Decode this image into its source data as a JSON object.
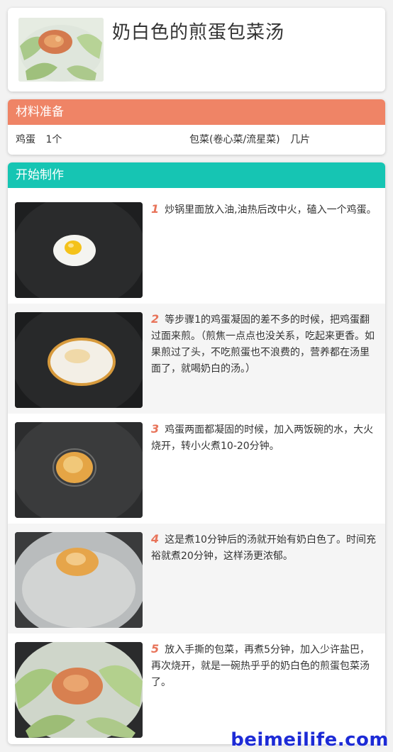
{
  "header": {
    "title": "奶白色的煎蛋包菜汤"
  },
  "ingredients": {
    "heading": "材料准备",
    "heading_color": "#ef8466",
    "items": [
      {
        "name": "鸡蛋",
        "amount": "1个"
      },
      {
        "name": "包菜(卷心菜/流星菜)",
        "amount": "几片"
      }
    ]
  },
  "steps": {
    "heading": "开始制作",
    "heading_color": "#16c5b3",
    "items": [
      {
        "num": "1",
        "text": "炒锅里面放入油,油热后改中火，磕入一个鸡蛋。"
      },
      {
        "num": "2",
        "text": "等步骤1的鸡蛋凝固的差不多的时候，把鸡蛋翻过面来煎。（煎焦一点点也没关系，吃起来更香。如果煎过了头，不吃煎蛋也不浪费的，营养都在汤里面了，就喝奶白的汤。）"
      },
      {
        "num": "3",
        "text": "鸡蛋两面都凝固的时候，加入两饭碗的水，大火烧开，转小火煮10-20分钟。"
      },
      {
        "num": "4",
        "text": "这是煮10分钟后的汤就开始有奶白色了。时间充裕就煮20分钟，这样汤更浓郁。"
      },
      {
        "num": "5",
        "text": "放入手撕的包菜，再煮5分钟，加入少许盐巴，再次烧开，就是一碗热乎乎的奶白色的煎蛋包菜汤了。"
      }
    ]
  },
  "watermark": "beimeilife.com",
  "accent_number_color": "#e8745a"
}
